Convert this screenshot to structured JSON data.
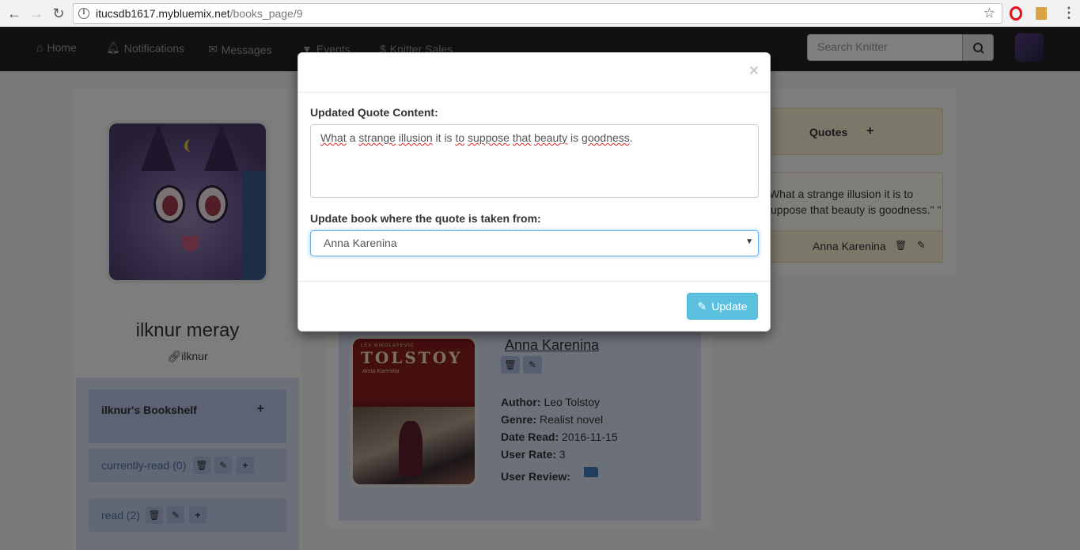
{
  "browser": {
    "url_host": "itucsdb1617.mybluemix.net",
    "url_path": "/books_page/9"
  },
  "navbar": {
    "items": [
      {
        "label": "Home",
        "icon": "home-icon"
      },
      {
        "label": "Notifications",
        "icon": "bell-icon"
      },
      {
        "label": "Messages",
        "icon": "envelope-icon"
      },
      {
        "label": "Events",
        "icon": "filter-icon"
      },
      {
        "label": "Knitter Sales",
        "icon": "dollar-icon"
      }
    ],
    "search_placeholder": "Search Knitter"
  },
  "profile": {
    "name": "ilknur meray",
    "handle": "ilknur"
  },
  "bookshelf": {
    "title": "ilknur's Bookshelf",
    "shelves": [
      {
        "label": "currently-read (0)"
      },
      {
        "label": "read (2)"
      }
    ]
  },
  "book": {
    "title": "Anna Karenina",
    "cover_author": "TOLSTOY",
    "cover_series": "LEV NIKOLAYEVIC",
    "cover_subtitle": "Anna Karenina",
    "author_label": "Author:",
    "author": "Leo Tolstoy",
    "genre_label": "Genre:",
    "genre": "Realist novel",
    "date_label": "Date Read:",
    "date": "2016-11-15",
    "rate_label": "User Rate:",
    "rate": "3",
    "review_label": "User Review:"
  },
  "quotes": {
    "header": "Quotes",
    "quote_text": "\"What a strange illusion it is to suppose that beauty is goodness.\" \"",
    "quote_book": "Anna Karenina"
  },
  "modal": {
    "close": "×",
    "content_label": "Updated Quote Content:",
    "content_words": [
      "What",
      " a ",
      "strange",
      " ",
      "illusion",
      " it is ",
      "to",
      " ",
      "suppose",
      " ",
      "that",
      " ",
      "beauty",
      " is ",
      "goodness",
      "."
    ],
    "book_label": "Update book where the quote is taken from:",
    "book_selected": "Anna Karenina",
    "update_button": "Update"
  }
}
